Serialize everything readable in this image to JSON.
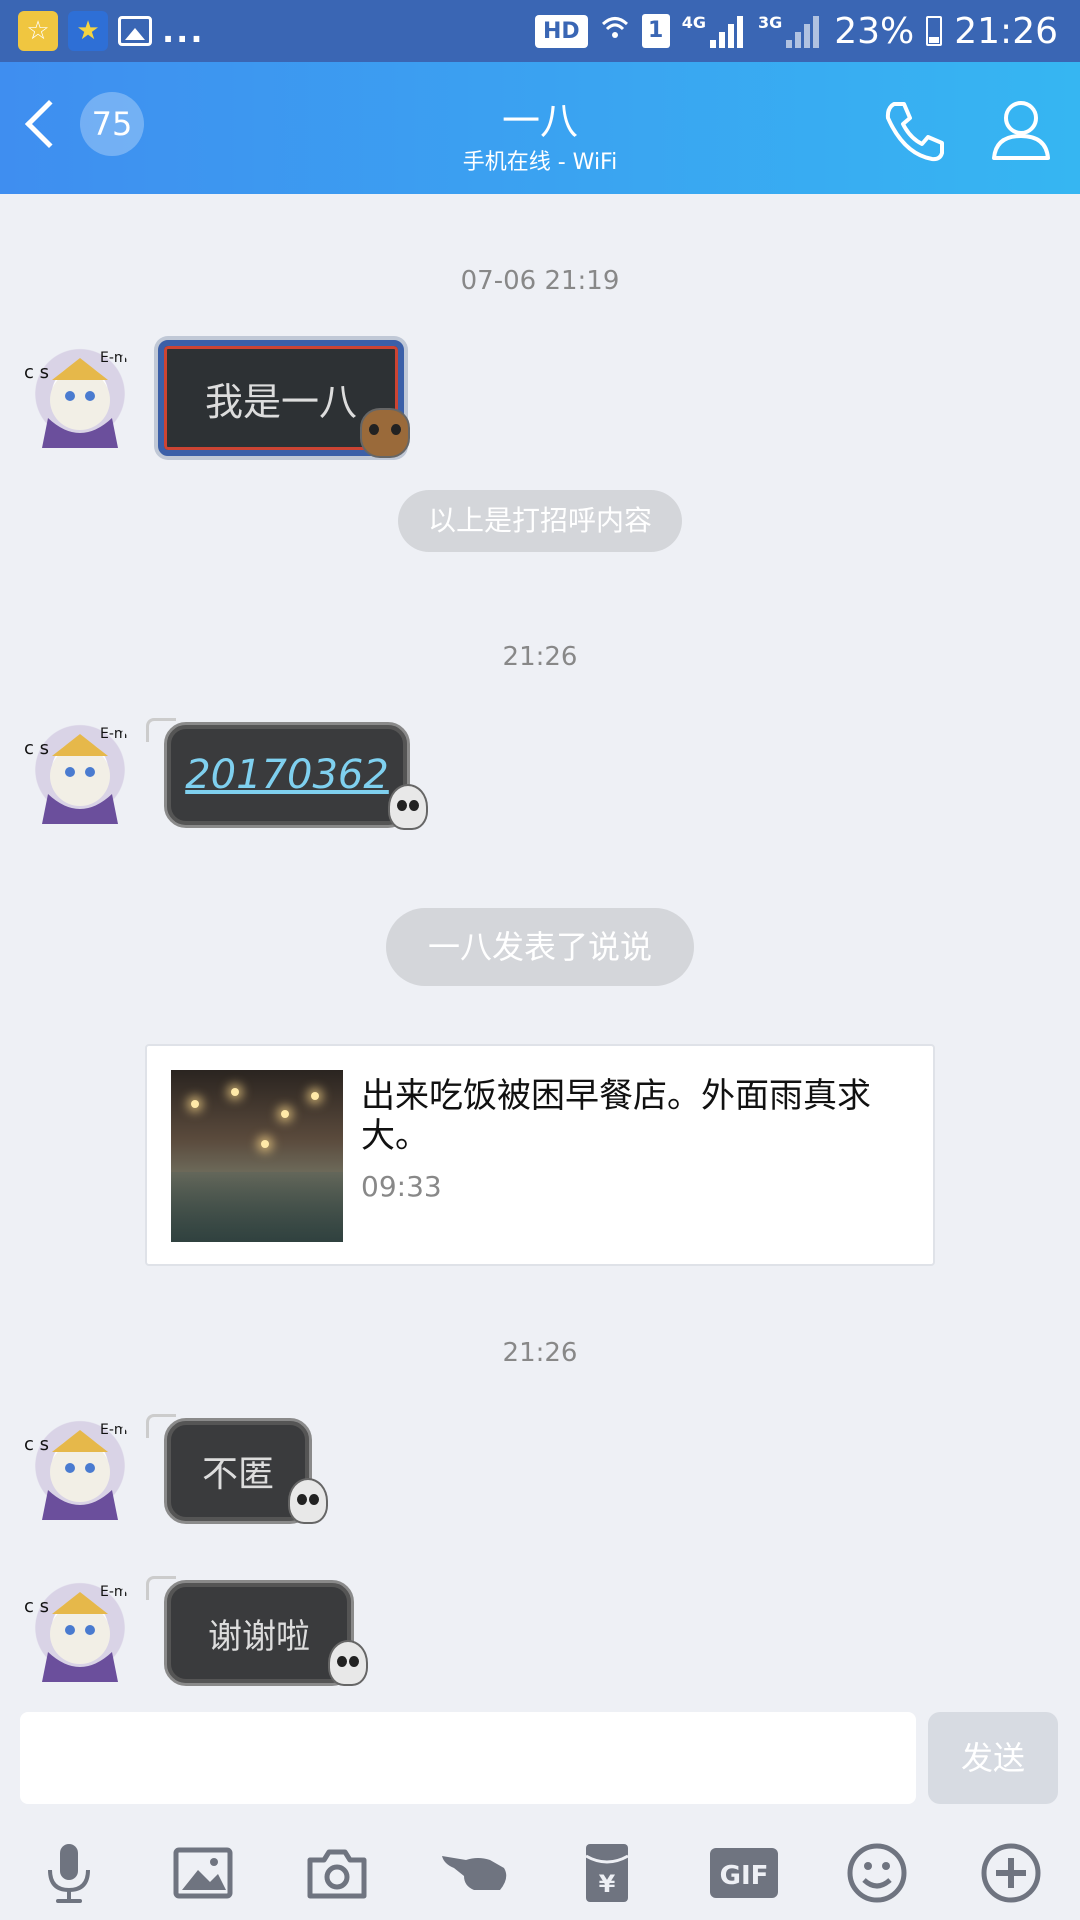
{
  "status_bar": {
    "more": "...",
    "hd": "HD",
    "sim": "1",
    "net1": "4G",
    "net2": "3G",
    "battery": "23%",
    "time": "21:26"
  },
  "header": {
    "back_count": "75",
    "title": "一八",
    "subtitle": "手机在线 - WiFi"
  },
  "chat": {
    "ts1": "07-06 21:19",
    "msg1": "我是一八",
    "notice1": "以上是打招呼内容",
    "ts2": "21:26",
    "msg2": "20170362",
    "notice2": "一八发表了说说",
    "post": {
      "text": "出来吃饭被困早餐店。外面雨真求大。",
      "time": "09:33"
    },
    "ts3": "21:26",
    "msg3": "不匿",
    "msg4": "谢谢啦"
  },
  "input": {
    "send_label": "发送"
  },
  "toolbar": {
    "gif_label": "GIF"
  },
  "colors": {
    "header_start": "#3f8ef0",
    "header_end": "#36b6f2",
    "status_bar": "#3a66b4",
    "background": "#eef0f5"
  }
}
